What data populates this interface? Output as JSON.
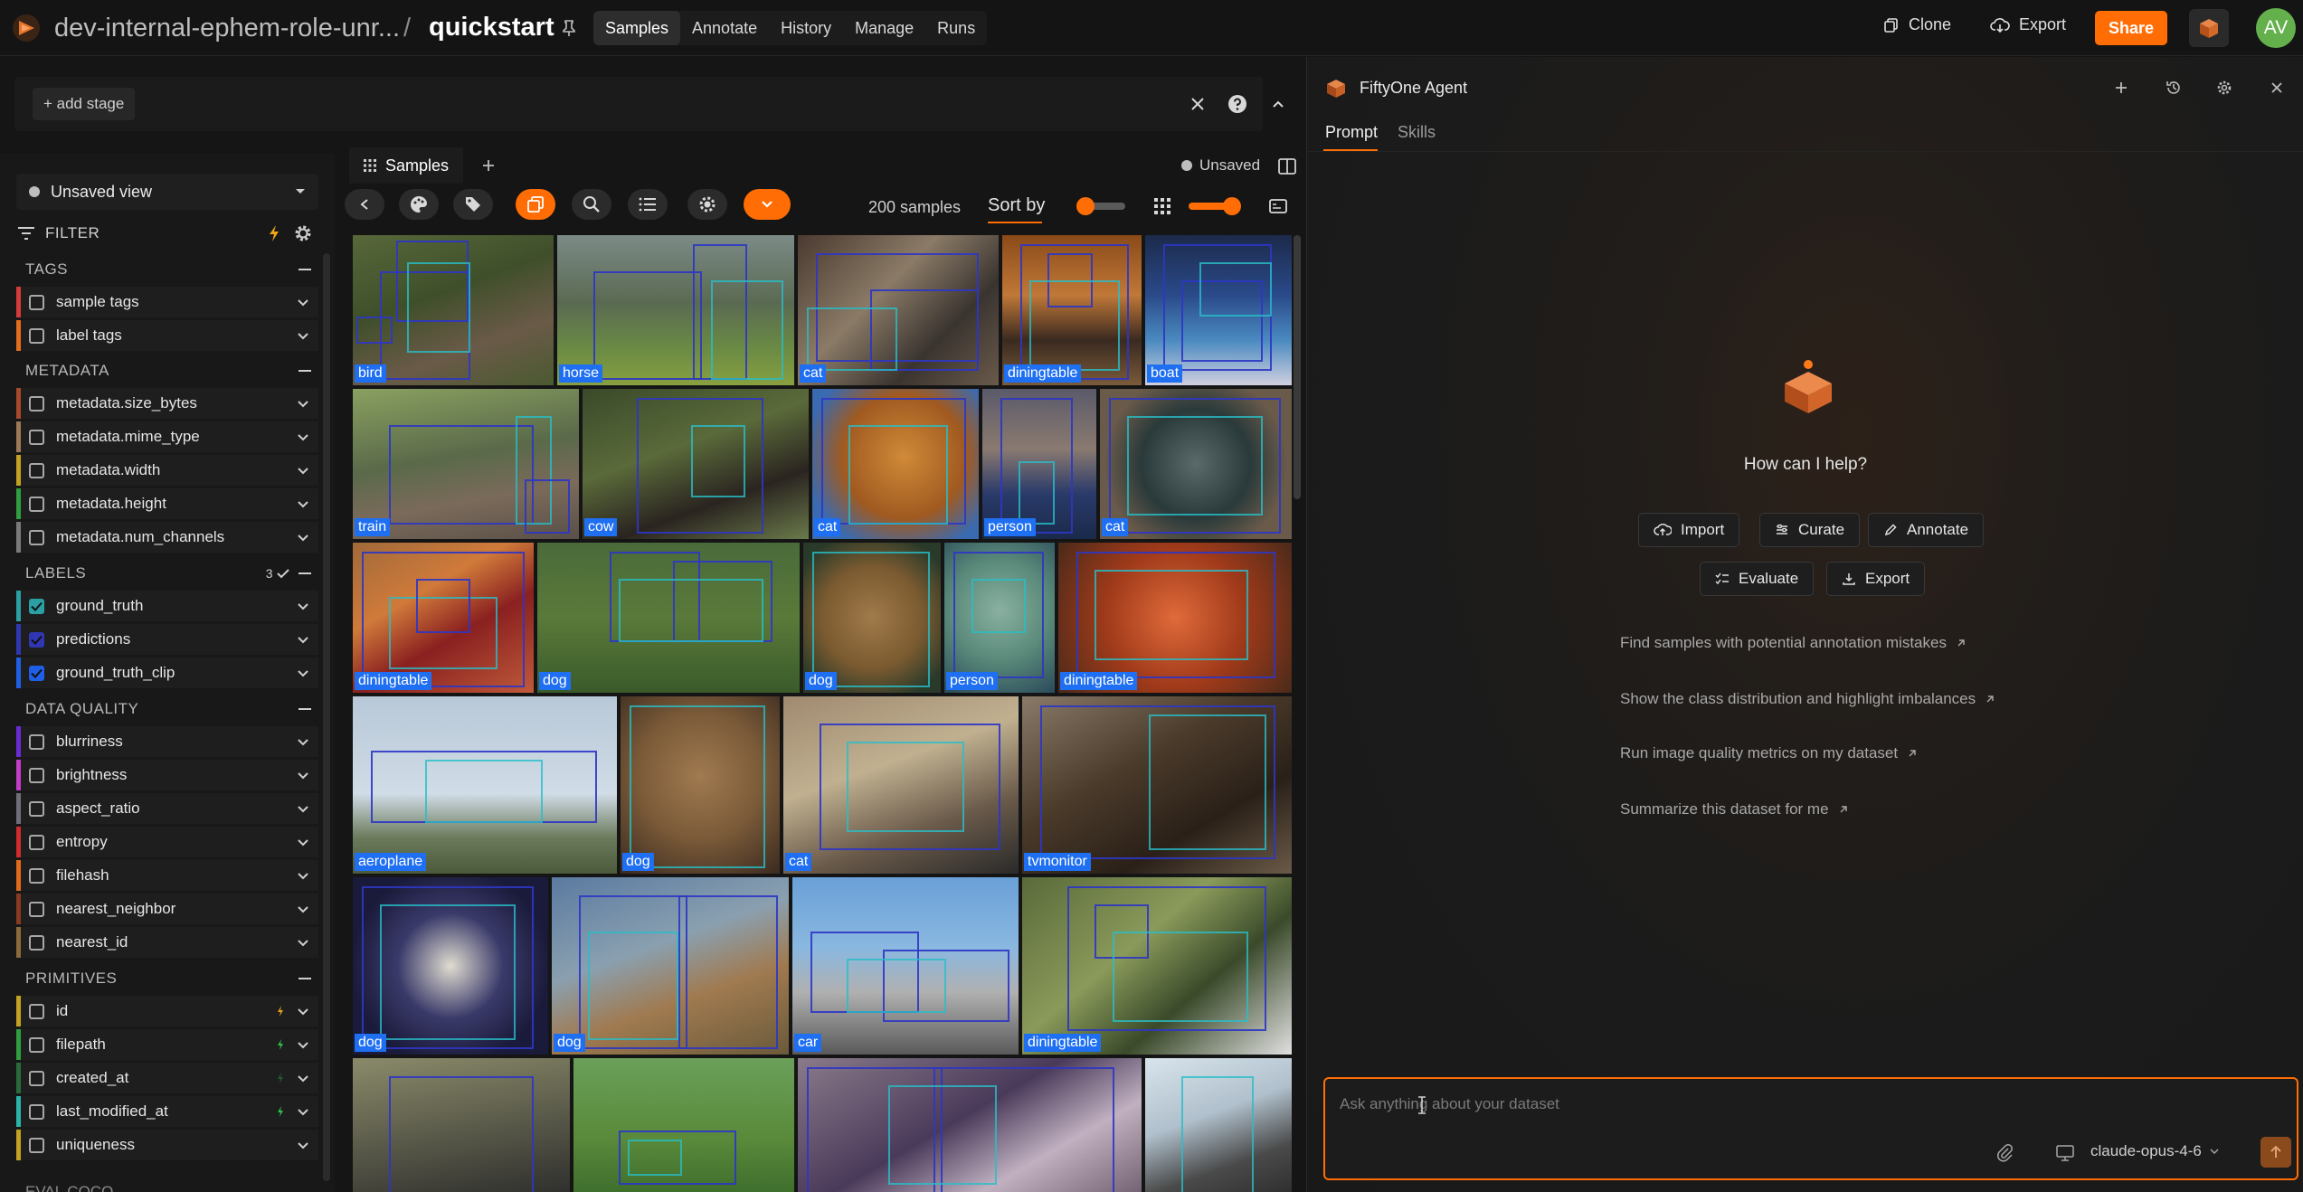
{
  "header": {
    "dataset_name": "dev-internal-ephem-role-unr...",
    "separator": "/",
    "subset_name": "quickstart",
    "nav_tabs": [
      "Samples",
      "Annotate",
      "History",
      "Manage",
      "Runs"
    ],
    "active_tab": "Samples",
    "clone_label": "Clone",
    "export_label": "Export",
    "share_label": "Share",
    "avatar_initials": "AV",
    "accent_color": "#ff6d04"
  },
  "viewbar": {
    "add_stage_label": "+ add stage"
  },
  "sidebar": {
    "view_select_label": "Unsaved view",
    "filter_label": "FILTER",
    "groups": {
      "tags": "TAGS",
      "metadata": "METADATA",
      "labels": "LABELS",
      "labels_count": "3",
      "data_quality": "DATA QUALITY",
      "primitives": "PRIMITIVES",
      "eval": "EVAL COCO"
    },
    "tags": [
      "sample tags",
      "label tags"
    ],
    "metadata": [
      "metadata.size_bytes",
      "metadata.mime_type",
      "metadata.width",
      "metadata.height",
      "metadata.num_channels"
    ],
    "labels": [
      "ground_truth",
      "predictions",
      "ground_truth_clip"
    ],
    "data_quality": [
      "blurriness",
      "brightness",
      "aspect_ratio",
      "entropy",
      "filehash",
      "nearest_neighbor",
      "nearest_id"
    ],
    "primitives": [
      "id",
      "filepath",
      "created_at",
      "last_modified_at",
      "uniqueness"
    ]
  },
  "samples": {
    "tab_label": "Samples",
    "status": "Unsaved",
    "count_label": "200 samples",
    "sort_by_label": "Sort by",
    "tile_labels": [
      "bird",
      "horse",
      "cat",
      "diningtable",
      "boat",
      "train",
      "cow",
      "cat",
      "person",
      "cat",
      "diningtable",
      "dog",
      "dog",
      "person",
      "diningtable",
      "aeroplane",
      "dog",
      "cat",
      "tvmonitor",
      "dog",
      "dog",
      "car",
      "diningtable"
    ]
  },
  "agent": {
    "title": "FiftyOne Agent",
    "tabs": [
      "Prompt",
      "Skills"
    ],
    "help_text": "How can I help?",
    "actions": [
      "Import",
      "Curate",
      "Annotate",
      "Evaluate",
      "Export"
    ],
    "suggestions": [
      "Find samples with potential annotation mistakes",
      "Show the class distribution and highlight imbalances",
      "Run image quality metrics on my dataset",
      "Summarize this dataset for me"
    ],
    "input_placeholder": "Ask anything about your dataset",
    "model": "claude-opus-4-6"
  }
}
